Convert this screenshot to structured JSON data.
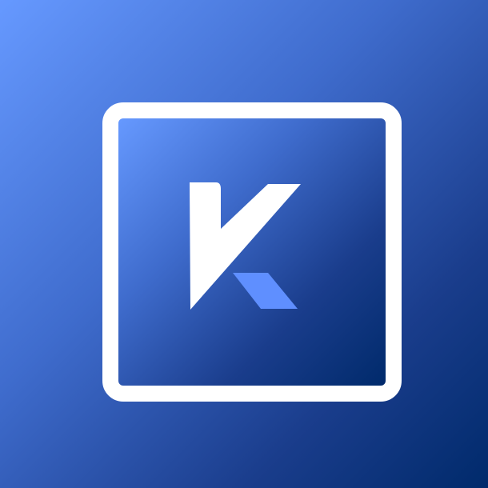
{
  "logo": {
    "icon": "k-letter-logo-icon",
    "frame_color": "#ffffff",
    "letter_color": "#ffffff",
    "accent_color": "#5f8fff",
    "background_gradient": [
      "#6699ff",
      "#002a6b"
    ]
  }
}
